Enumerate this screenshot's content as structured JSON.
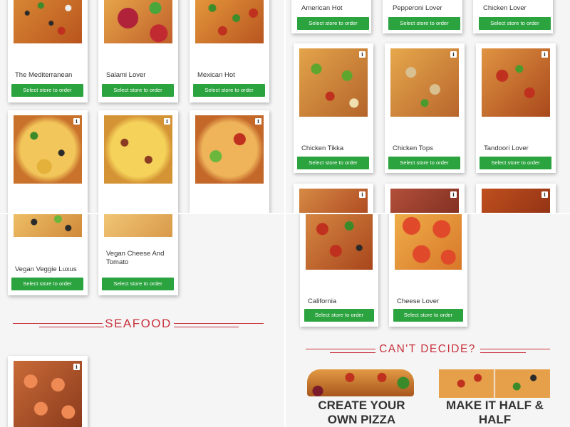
{
  "colors": {
    "button": "#2ba33f",
    "accent": "#c8323d",
    "card": "#ffffff",
    "background": "#f5f5f5"
  },
  "button_label": "Select store to order",
  "info_icon": "i",
  "q_tl": {
    "row1": [
      "The Mediterranean",
      "Salami Lover",
      "Mexican Hot"
    ],
    "row2": [
      "",
      "",
      ""
    ]
  },
  "q_tr": {
    "row1": [
      "American Hot",
      "Pepperoni Lover",
      "Chicken Lover"
    ],
    "row2": [
      "Chicken Tikka",
      "Chicken Tops",
      "Tandoori Lover"
    ]
  },
  "q_bl": {
    "row1": [
      "Vegan Veggie Luxus",
      "Vegan Cheese And Tomato"
    ],
    "section_title": "SEAFOOD"
  },
  "q_br": {
    "row1": [
      "California",
      "Cheese Lover"
    ],
    "section_title": "CAN'T DECIDE?",
    "cta_left": "CREATE YOUR OWN PIZZA",
    "cta_right": "MAKE IT HALF & HALF"
  }
}
